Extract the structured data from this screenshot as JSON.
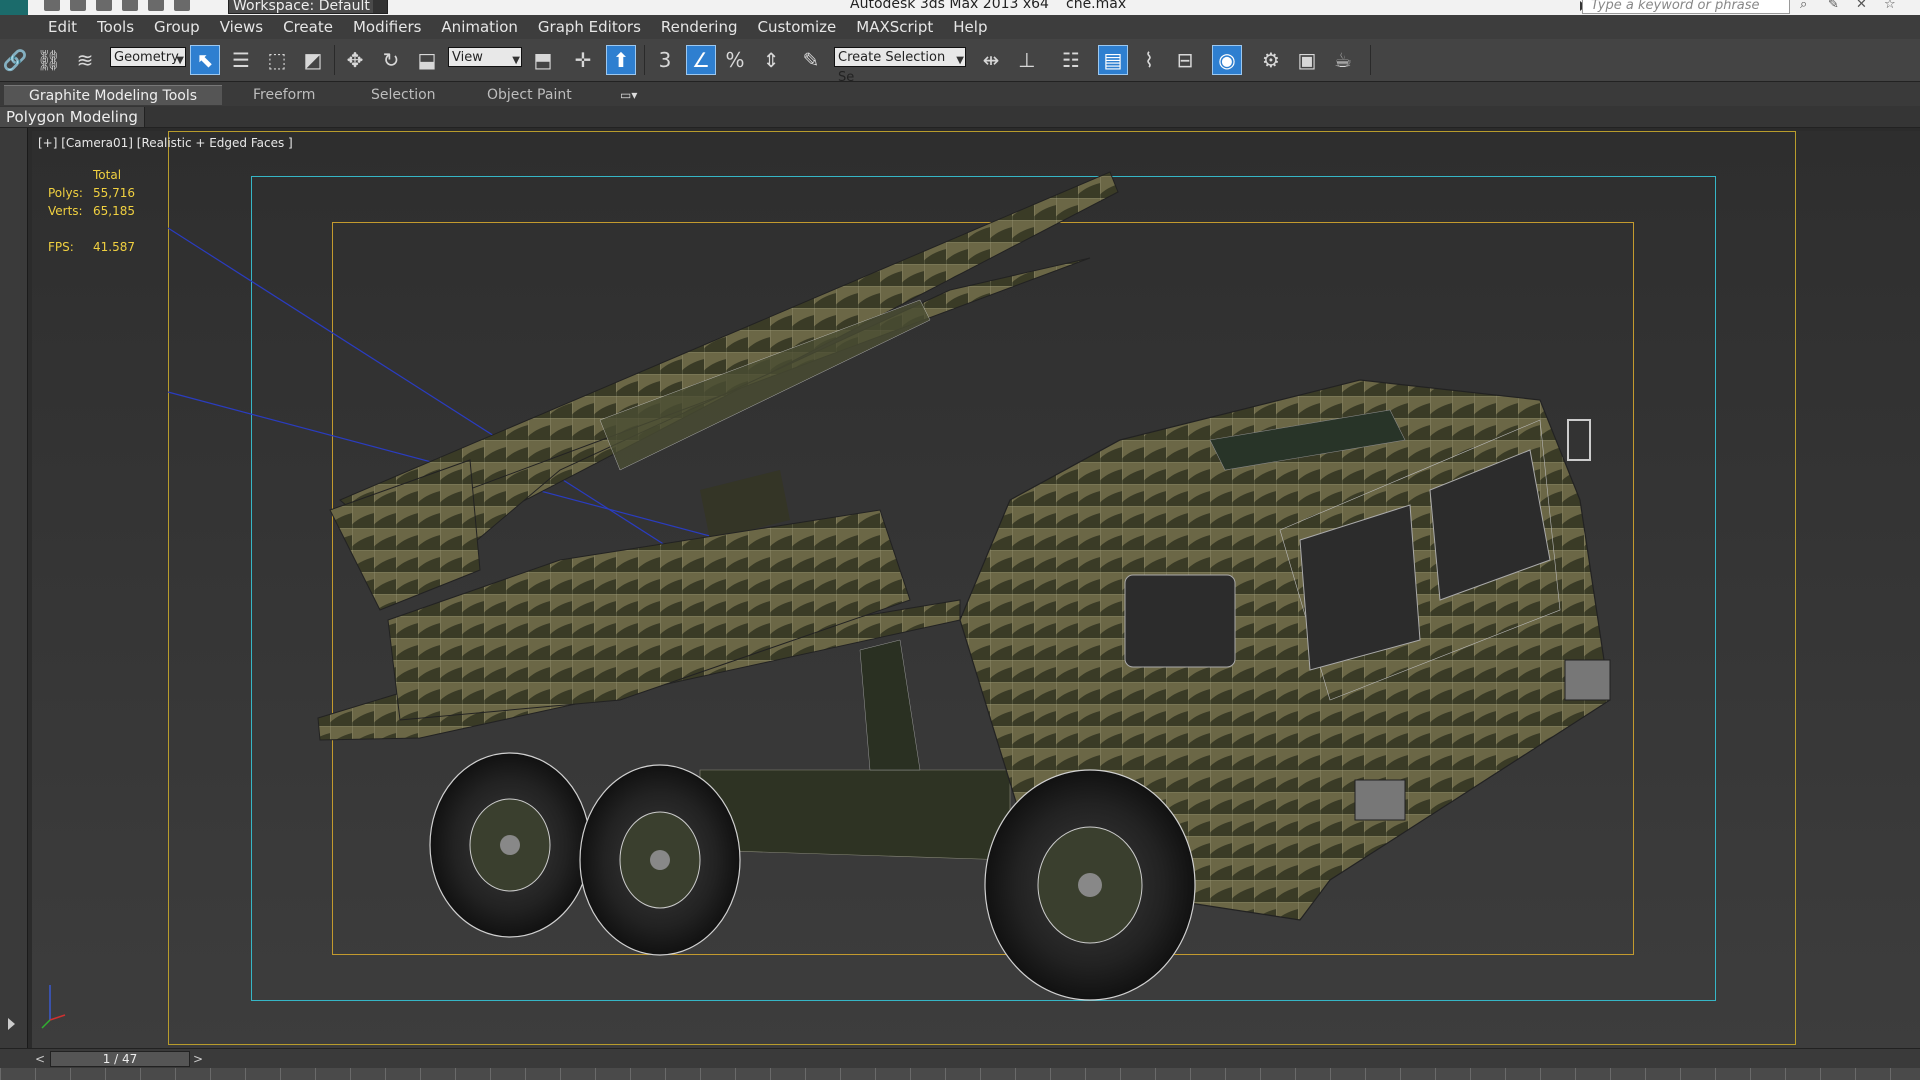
{
  "title_bar": {
    "workspace_label": "Workspace: Default",
    "app_title": "Autodesk 3ds Max  2013 x64",
    "file_name": "che.max",
    "search_placeholder": "Type a keyword or phrase"
  },
  "menu": [
    "Edit",
    "Tools",
    "Group",
    "Views",
    "Create",
    "Modifiers",
    "Animation",
    "Graph Editors",
    "Rendering",
    "Customize",
    "MAXScript",
    "Help"
  ],
  "toolbar": {
    "selection_filter": "Geometry",
    "reference_coord": "View",
    "named_selection": "Create Selection Se",
    "snap_label": "3"
  },
  "ribbon": {
    "tabs": [
      "Graphite Modeling Tools",
      "Freeform",
      "Selection",
      "Object Paint"
    ],
    "active_panel": "Polygon Modeling"
  },
  "viewport": {
    "label": "[+] [Camera01] [Realistic + Edged Faces ]",
    "stats": {
      "header": "Total",
      "polys_label": "Polys:",
      "polys_value": "55,716",
      "verts_label": "Verts:",
      "verts_value": "65,185",
      "fps_label": "FPS:",
      "fps_value": "41.587"
    }
  },
  "timeline": {
    "frame_display": "1 / 47",
    "prev_label": "<",
    "next_label": ">"
  },
  "colors": {
    "accent_active": "#2e7fd0",
    "safe_frame_outer": "#b89c2c",
    "safe_frame_cyan": "#36b6c6",
    "stats_text": "#f0d040"
  }
}
